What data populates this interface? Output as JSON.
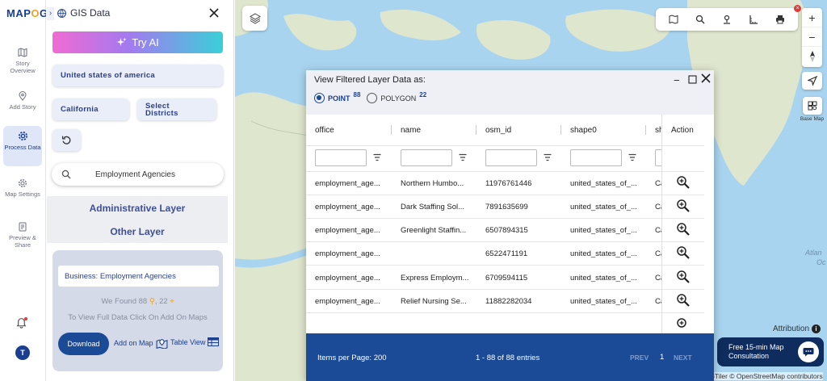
{
  "rail": {
    "logo_a": "MAP",
    "logo_o": "O",
    "logo_b": "G",
    "items": [
      {
        "label": "Story Overview"
      },
      {
        "label": "Add Story"
      },
      {
        "label": "Process Data"
      },
      {
        "label": "Map Settings"
      },
      {
        "label": "Preview & Share"
      }
    ],
    "avatar": "T"
  },
  "panel": {
    "title": "GIS Data",
    "try_ai": "Try AI",
    "country": "United states of america",
    "state": "California",
    "districts_line1": "Select",
    "districts_line2": "Districts",
    "search_query": "Employment Agencies",
    "admin_layer": "Administrative Layer",
    "other_layer": "Other Layer",
    "card_title": "Business: Employment Agencies",
    "found_prefix": "We Found",
    "found_points": "88",
    "found_polygons": "22",
    "hint": "To View Full Data Click On Add On Maps",
    "download": "Download",
    "add_on_map": "Add on Map",
    "table_view": "Table View"
  },
  "map": {
    "basemap_label": "Base Map",
    "attribution": "Attribution",
    "osm": "pTiler © OpenStreetMap contributors",
    "label_a": "Atlan",
    "label_oc": "Oc",
    "consult_line1": "Free 15-min Map",
    "consult_line2": "Consultation"
  },
  "dialog": {
    "title": "View Filtered Layer Data as:",
    "point_label": "POINT",
    "point_count": "88",
    "polygon_label": "POLYGON",
    "polygon_count": "22",
    "columns": [
      "office",
      "name",
      "osm_id",
      "shape0",
      "sh",
      "Action"
    ],
    "rows": [
      {
        "office": "employment_age...",
        "name": "Northern Humbo...",
        "osm_id": "11976761446",
        "shape0": "united_states_of_...",
        "sh": "Ca"
      },
      {
        "office": "employment_age...",
        "name": "Dark Staffing Sol...",
        "osm_id": "7891635699",
        "shape0": "united_states_of_...",
        "sh": "Ca"
      },
      {
        "office": "employment_age...",
        "name": "Greenlight Staffin...",
        "osm_id": "6507894315",
        "shape0": "united_states_of_...",
        "sh": "Ca"
      },
      {
        "office": "employment_age...",
        "name": "",
        "osm_id": "6522471191",
        "shape0": "united_states_of_...",
        "sh": "Ca"
      },
      {
        "office": "employment_age...",
        "name": "Express Employm...",
        "osm_id": "6709594115",
        "shape0": "united_states_of_...",
        "sh": "Ca"
      },
      {
        "office": "employment_age...",
        "name": "Relief Nursing Se...",
        "osm_id": "11882282034",
        "shape0": "united_states_of_...",
        "sh": "Ca"
      }
    ],
    "items_per_page": "Items per Page: 200",
    "entries": "1 - 88 of 88 entries",
    "prev": "PREV",
    "page": "1",
    "next": "NEXT"
  },
  "colors": {
    "brand": "#1b3f8f",
    "accent": "#f2a31b",
    "footer": "#1b4a96",
    "ocean": "#a9d4ef",
    "land": "#dfe6ce"
  }
}
